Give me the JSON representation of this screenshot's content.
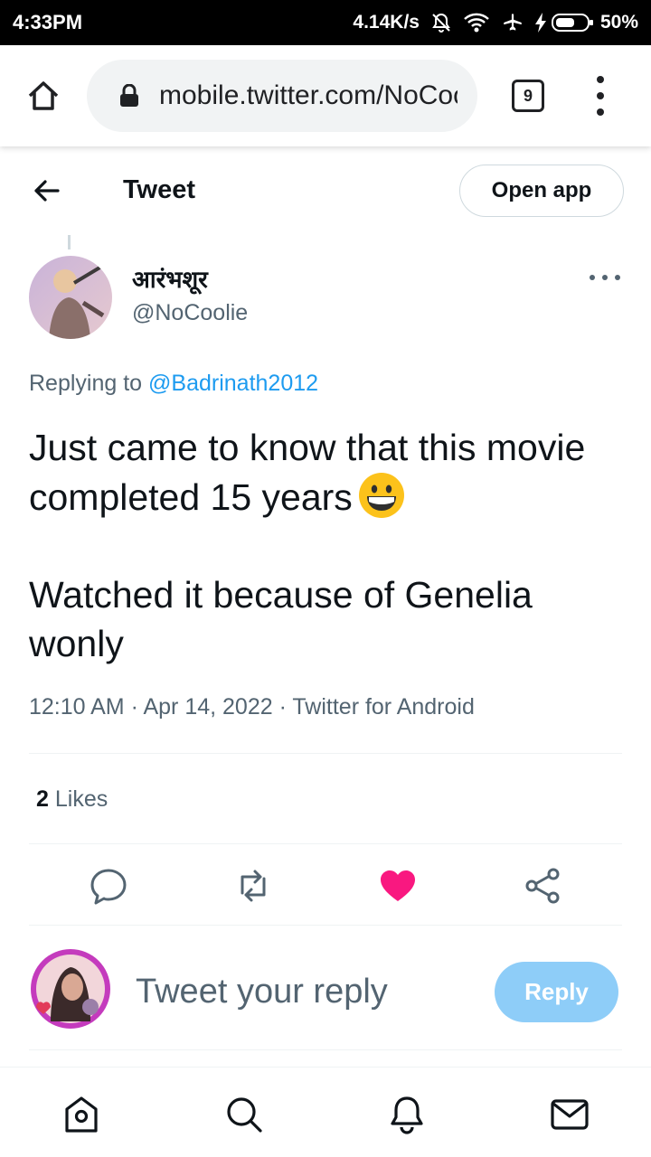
{
  "status_bar": {
    "time": "4:33PM",
    "network_speed": "4.14K/s",
    "battery_percent": "50%",
    "icons": [
      "mute-icon",
      "wifi-icon",
      "airplane-icon",
      "charging-icon",
      "battery-icon"
    ]
  },
  "browser": {
    "url": "mobile.twitter.com/NoCoolie",
    "tab_count": "9",
    "icons": [
      "home-icon",
      "lock-icon",
      "tabs-icon",
      "menu-icon"
    ]
  },
  "header": {
    "title": "Tweet",
    "open_app_label": "Open app"
  },
  "tweet": {
    "author_name": "आरंभशूर",
    "author_handle": "@NoCoolie",
    "replying_prefix": "Replying to",
    "replying_to": "@Badrinath2012",
    "text_line1": "Just came to know that this movie completed 15 years",
    "text_line2": "Watched it because of Genelia wonly",
    "emoji": "grinning-face-emoji",
    "timestamp": "12:10 AM · Apr 14, 2022 · Twitter for Android",
    "likes_count": "2",
    "likes_label": "Likes",
    "liked": true
  },
  "actions": [
    "reply-icon",
    "retweet-icon",
    "like-icon",
    "share-icon"
  ],
  "reply_box": {
    "placeholder": "Tweet your reply",
    "button_label": "Reply"
  },
  "bottom_nav": [
    "home-icon",
    "search-icon",
    "notifications-icon",
    "messages-icon"
  ],
  "colors": {
    "accent": "#1d9bf0",
    "like": "#f91880",
    "reply_button": "#8ecdf8",
    "secondary_text": "#536471"
  }
}
